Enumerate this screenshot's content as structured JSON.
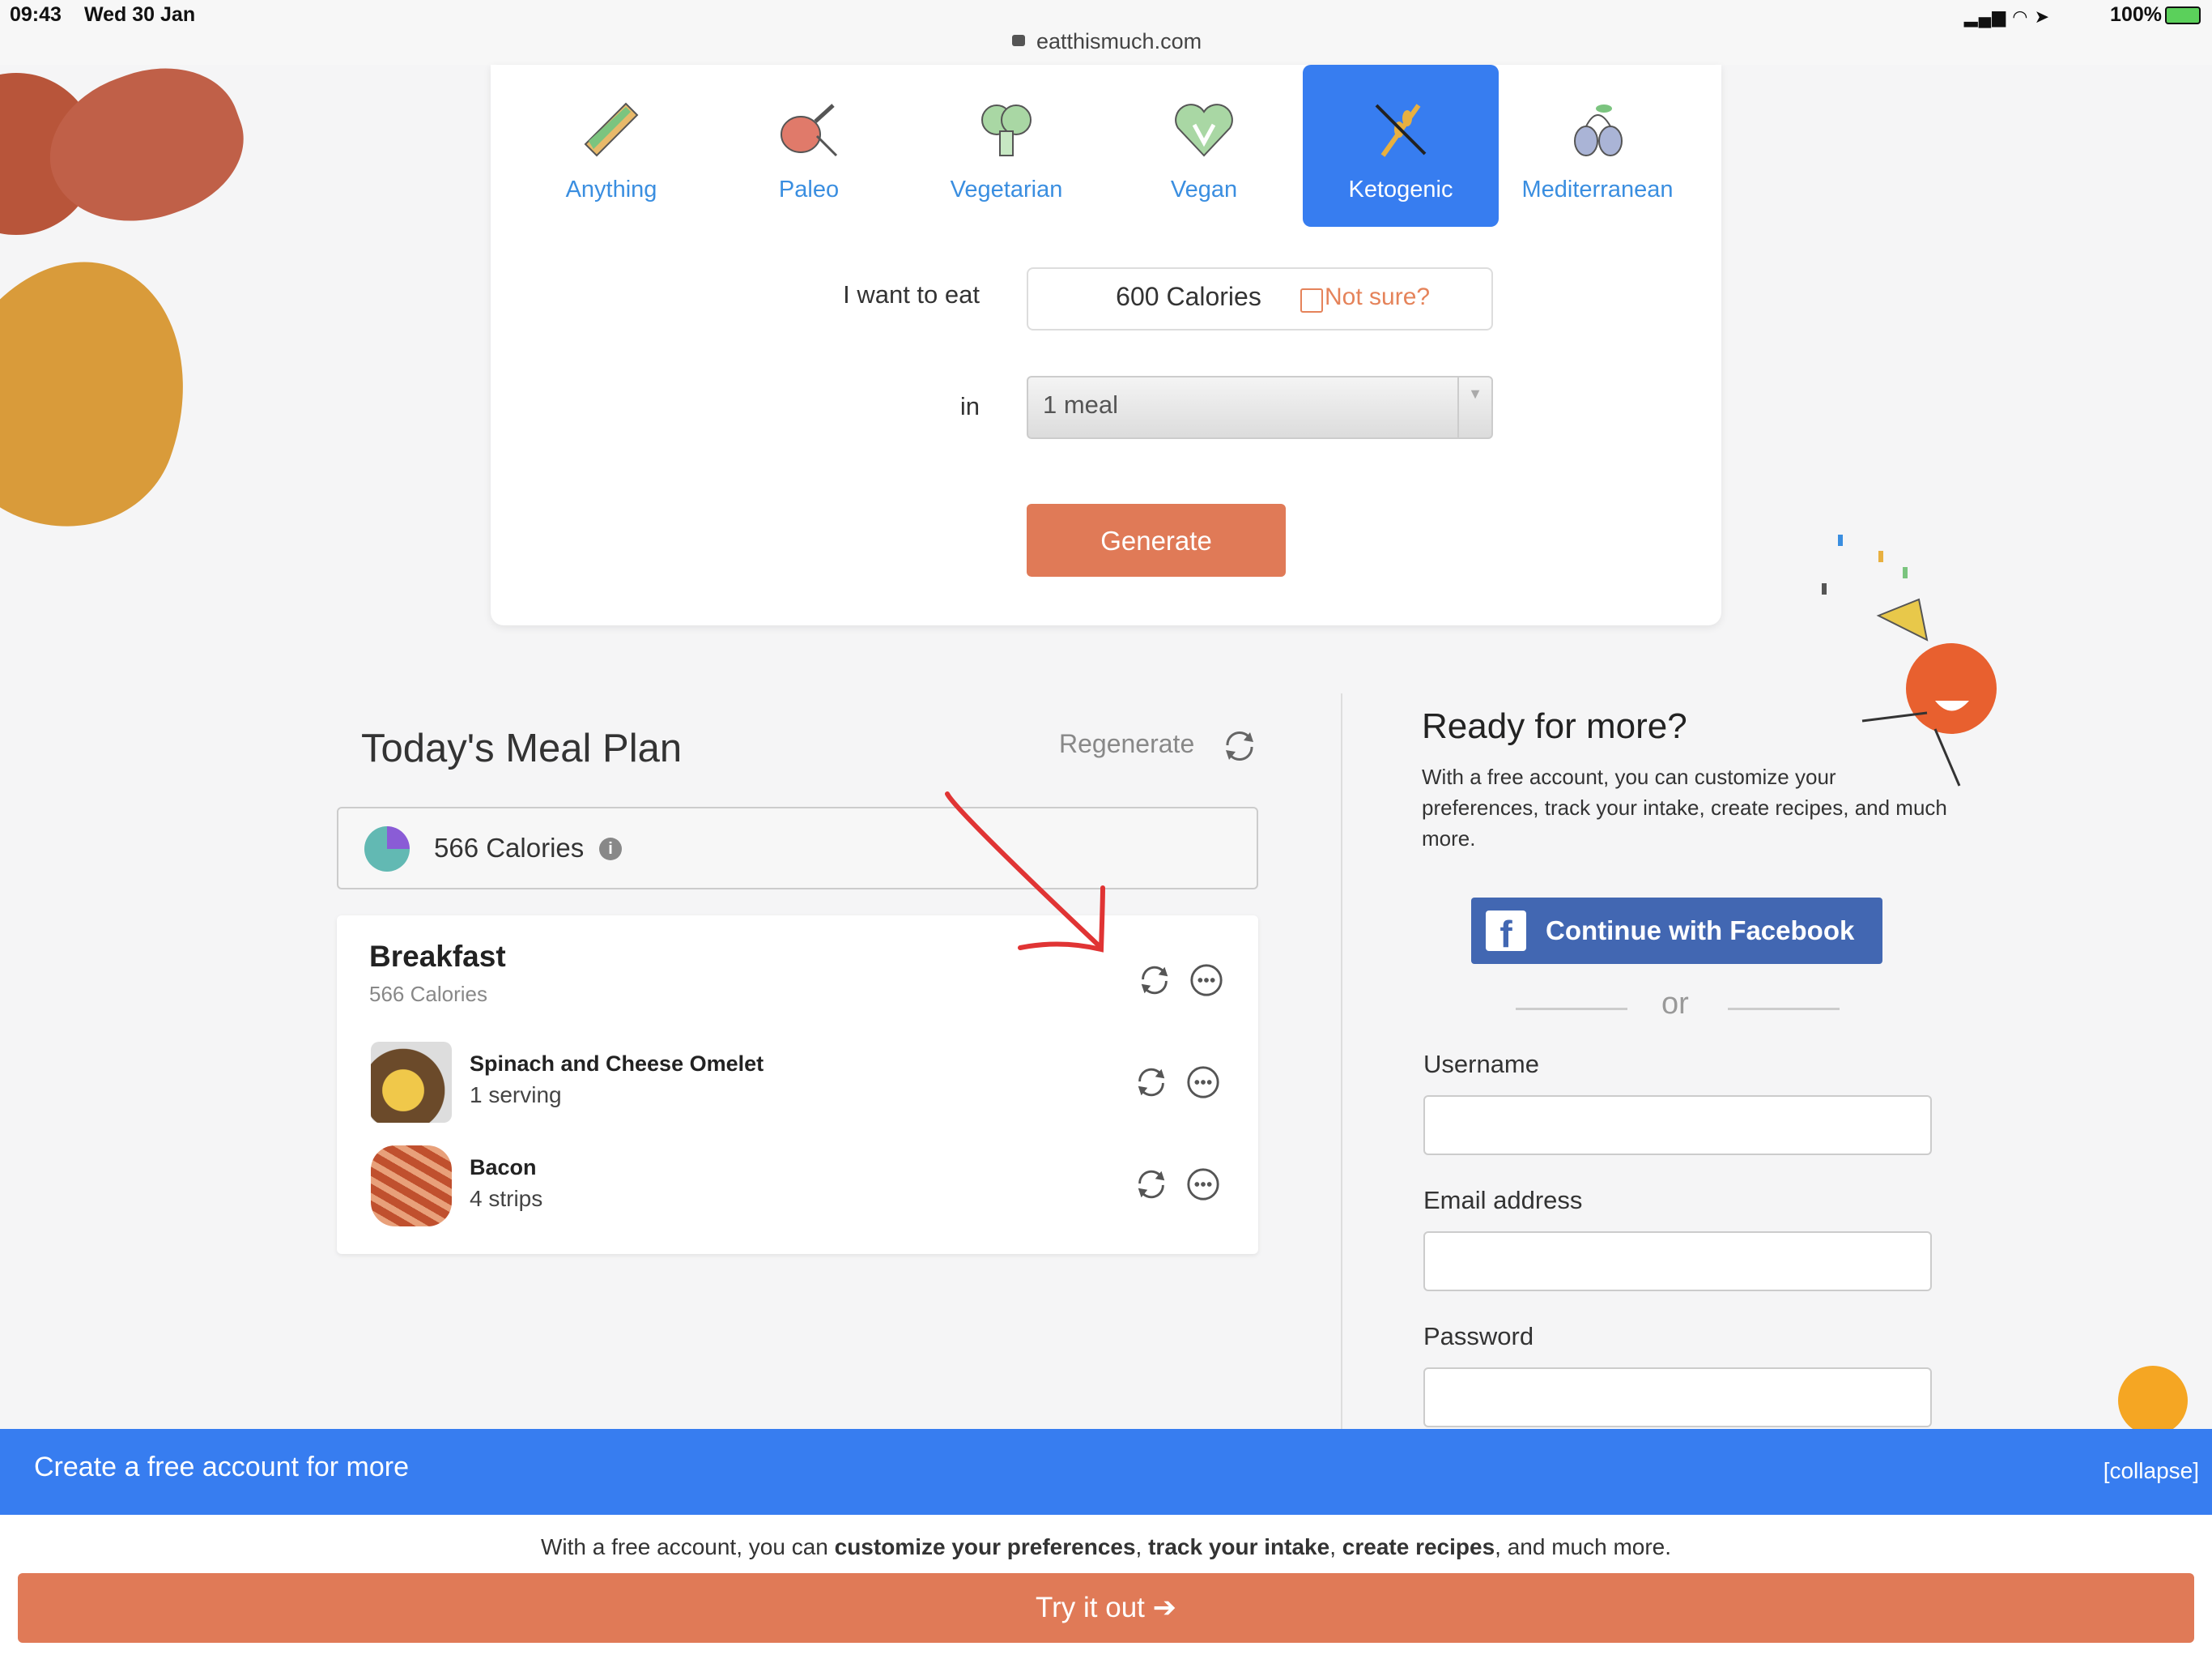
{
  "status_bar": {
    "time": "09:43",
    "date": "Wed 30 Jan",
    "url": "eatthismuch.com",
    "battery": "100%"
  },
  "diet_options": [
    {
      "label": "Anything",
      "icon": "sandwich-icon",
      "active": false
    },
    {
      "label": "Paleo",
      "icon": "meat-leg-icon",
      "active": false
    },
    {
      "label": "Vegetarian",
      "icon": "broccoli-icon",
      "active": false
    },
    {
      "label": "Vegan",
      "icon": "heart-v-icon",
      "active": false
    },
    {
      "label": "Ketogenic",
      "icon": "no-wheat-icon",
      "active": true
    },
    {
      "label": "Mediterranean",
      "icon": "olives-icon",
      "active": false
    }
  ],
  "form": {
    "eat_label": "I want to eat",
    "calories_value": "600 Calories",
    "not_sure": "Not sure?",
    "in_label": "in",
    "meals_value": "1 meal",
    "generate": "Generate"
  },
  "meal_plan": {
    "title": "Today's Meal Plan",
    "regenerate": "Regenerate",
    "total_calories": "566 Calories",
    "meal": {
      "title": "Breakfast",
      "calories": "566 Calories",
      "items": [
        {
          "name": "Spinach and Cheese Omelet",
          "amount": "1 serving"
        },
        {
          "name": "Bacon",
          "amount": "4 strips"
        }
      ]
    }
  },
  "signup": {
    "title": "Ready for more?",
    "text": "With a free account, you can customize your preferences, track your intake, create recipes, and much more.",
    "facebook": "Continue with Facebook",
    "or": "or",
    "username_label": "Username",
    "email_label": "Email address",
    "password_label": "Password"
  },
  "banner": {
    "title": "Create a free account for more",
    "collapse": "[collapse]",
    "text_parts": [
      "With a free account, you can ",
      "customize your preferences",
      ", ",
      "track your intake",
      ", ",
      "create recipes",
      ", and much more."
    ],
    "cta": "Try it out"
  },
  "colors": {
    "accent_blue": "#377df0",
    "accent_orange": "#e07a57",
    "facebook_blue": "#4267b2"
  }
}
